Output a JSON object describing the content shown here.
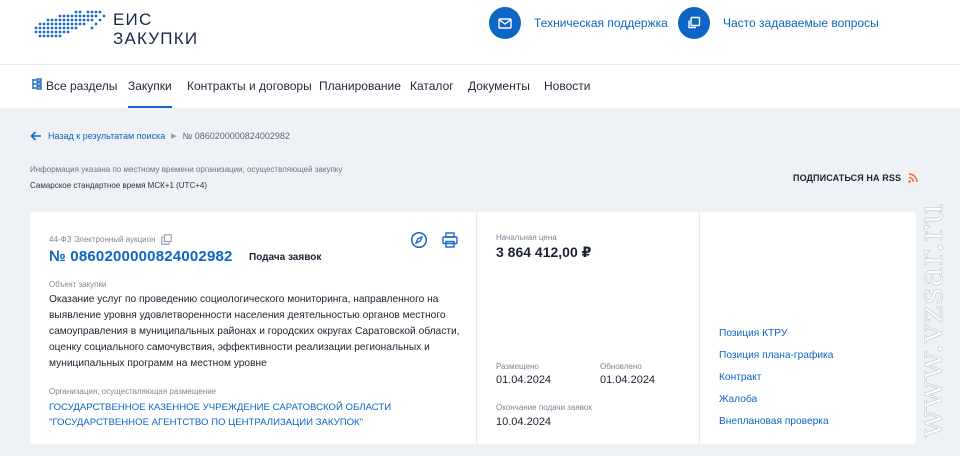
{
  "header": {
    "logo_line1": "ЕИС",
    "logo_line2": "ЗАКУПКИ",
    "support_label": "Техническая поддержка",
    "faq_label": "Часто задаваемые вопросы"
  },
  "nav": {
    "items": [
      {
        "label": "Все разделы"
      },
      {
        "label": "Закупки"
      },
      {
        "label": "Контракты и договоры"
      },
      {
        "label": "Планирование"
      },
      {
        "label": "Каталог"
      },
      {
        "label": "Документы"
      },
      {
        "label": "Новости"
      }
    ],
    "active": "Закупки"
  },
  "breadcrumb": {
    "back_label": "Назад к результатам поиска",
    "current": "№ 0860200000824002982"
  },
  "timezone_info": {
    "line1": "Информация указана по местному времени организации, осуществляющей закупку",
    "line2": "Самарское стандартное время МСК+1 (UTC+4)"
  },
  "rss_label": "ПОДПИСАТЬСЯ НА RSS",
  "purchase": {
    "type": "44-ФЗ Электронный аукцион",
    "number": "№ 0860200000824002982",
    "status": "Подача заявок",
    "object_label": "Объект закупки",
    "object_text": "Оказание услуг по проведению социологического мониторинга, направленного на выявление уровня удовлетворенности населения деятельностью органов местного самоуправления в муниципальных районах и городских округах Саратовской области, оценку социального самочувствия, эффективности реализации региональных и муниципальных программ на местном уровне",
    "org_label": "Организация, осуществляющая размещение",
    "org_name": "ГОСУДАРСТВЕННОЕ КАЗЕННОЕ УЧРЕЖДЕНИЕ САРАТОВСКОЙ ОБЛАСТИ \"ГОСУДАРСТВЕННОЕ АГЕНТСТВО ПО ЦЕНТРАЛИЗАЦИИ ЗАКУПОК\""
  },
  "pricing": {
    "start_price_label": "Начальная цена",
    "start_price": "3 864 412,00 ₽",
    "posted_label": "Размещено",
    "posted_date": "01.04.2024",
    "updated_label": "Обновлено",
    "updated_date": "01.04.2024",
    "deadline_label": "Окончание подачи заявок",
    "deadline_date": "10.04.2024"
  },
  "links": {
    "items": [
      {
        "label": "Позиция КТРУ"
      },
      {
        "label": "Позиция плана-графика"
      },
      {
        "label": "Контракт"
      },
      {
        "label": "Жалоба"
      },
      {
        "label": "Внеплановая проверка"
      }
    ]
  },
  "watermark": "www.vzsar.ru",
  "colors": {
    "accent": "#0d65c5",
    "page_bg": "#eef1f6",
    "text": "#1b2230",
    "rss": "#f26522"
  },
  "icons": {
    "support": "mail-icon",
    "faq": "chat-icon",
    "all_sections": "grid-icon",
    "back": "arrow-left-icon",
    "copy": "copy-icon",
    "edit": "compass-icon",
    "print": "printer-icon",
    "rss": "rss-icon"
  }
}
